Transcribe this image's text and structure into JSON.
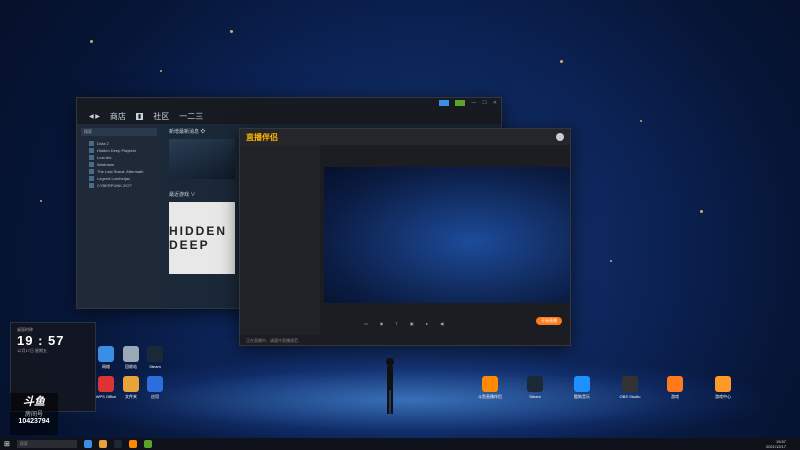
{
  "steam": {
    "nav": [
      "商店",
      "社区",
      "一二三"
    ],
    "search_placeholder": "搜索",
    "section_new": "新增最新消息 ❖",
    "section_recent": "最近游戏 ∨",
    "featured_game": "HIDDEN DEEP",
    "games": [
      "Dota 2",
      "Hidden Deep Playtest",
      "Lost Ark",
      "Warframe",
      "The Last Stand: Aftermath",
      "Legend Lumberjac",
      "CYBERPUNK 2077"
    ]
  },
  "live": {
    "app_title": "直播伴侣",
    "golive_label": "开始直播",
    "footer": "正在直播中，请遵守直播规范"
  },
  "clock": {
    "title": "桌面时钟",
    "time": "19 : 57",
    "date": "12月17日 星期五"
  },
  "badge": {
    "brand": "斗鱼",
    "sub": "房间号",
    "room": "10423794"
  },
  "desktop_icons": [
    {
      "name": "network-icon",
      "label": "网络",
      "color": "#3a8ee6"
    },
    {
      "name": "recycle-bin-icon",
      "label": "回收站",
      "color": "#9aa8b8"
    },
    {
      "name": "steam-icon",
      "label": "Steam",
      "color": "#1b2838"
    },
    {
      "name": "wps-icon",
      "label": "WPS Office",
      "color": "#d33"
    },
    {
      "name": "folder-icon",
      "label": "文件夹",
      "color": "#e8a33a"
    },
    {
      "name": "app-icon",
      "label": "应用",
      "color": "#2c6fdc"
    },
    {
      "name": "douyu-icon",
      "label": "斗鱼直播伴侣",
      "color": "#ff8a00"
    },
    {
      "name": "steam-icon-2",
      "label": "Steam",
      "color": "#1b2838"
    },
    {
      "name": "kugou-icon",
      "label": "酷狗音乐",
      "color": "#1e90ff"
    },
    {
      "name": "obs-icon",
      "label": "OBS Studio",
      "color": "#333"
    },
    {
      "name": "game-icon",
      "label": "游戏",
      "color": "#ff7a1a"
    },
    {
      "name": "game-icon-2",
      "label": "游戏中心",
      "color": "#ff9a2a"
    }
  ],
  "taskbar": {
    "search_placeholder": "搜索",
    "time": "19:57",
    "date": "2021/12/17"
  }
}
